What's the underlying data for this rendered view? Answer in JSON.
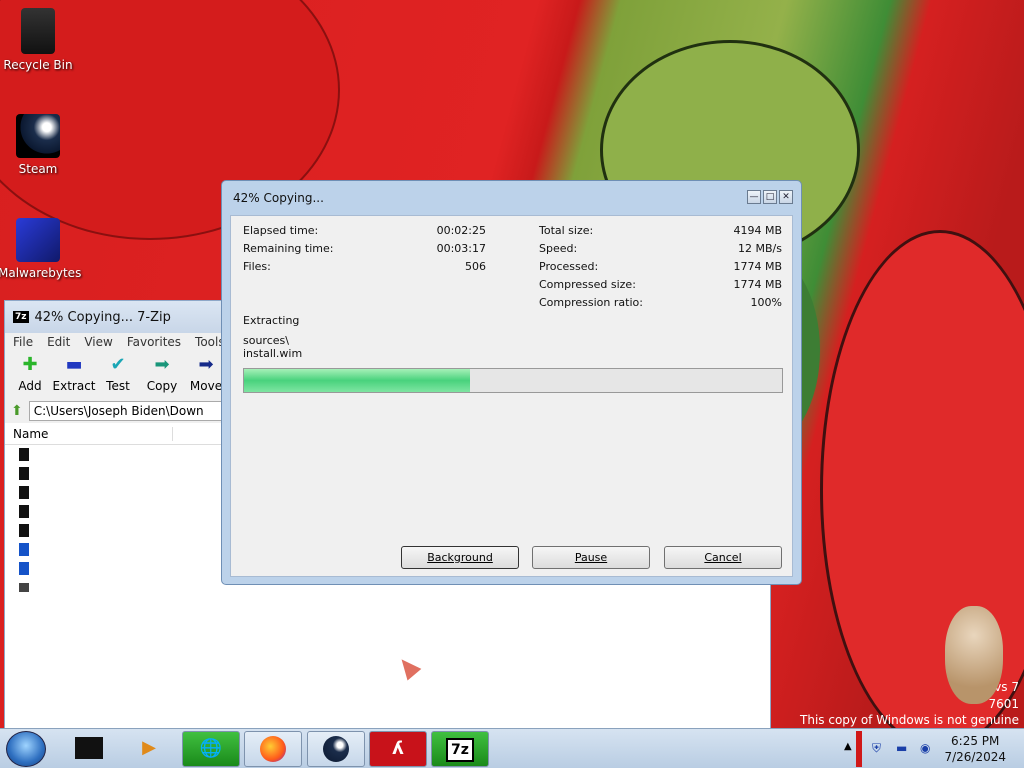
{
  "desktop": {
    "icons": [
      {
        "label": "Recycle Bin"
      },
      {
        "label": "Steam"
      },
      {
        "label": "Malwarebytes"
      }
    ],
    "watermark": {
      "line1": "vs 7",
      "line2": "7601",
      "line3": "This copy of Windows is not genuine"
    }
  },
  "zip_window": {
    "title": "42% Copying... 7-Zip",
    "logo": "7z",
    "menu": [
      "File",
      "Edit",
      "View",
      "Favorites",
      "Tools"
    ],
    "toolbar": [
      "Add",
      "Extract",
      "Test",
      "Copy",
      "Move"
    ],
    "address": "C:\\Users\\Joseph Biden\\Down",
    "columns": [
      "Name"
    ]
  },
  "dialog": {
    "title": "42% Copying...",
    "controls": {
      "minimize": "—",
      "maximize": "□",
      "close": "✕"
    },
    "left_stats": [
      {
        "label": "Elapsed time:",
        "value": "00:02:25"
      },
      {
        "label": "Remaining time:",
        "value": "00:03:17"
      },
      {
        "label": "Files:",
        "value": "506"
      }
    ],
    "right_stats": [
      {
        "label": "Total size:",
        "value": "4194 MB"
      },
      {
        "label": "Speed:",
        "value": "12 MB/s"
      },
      {
        "label": "Processed:",
        "value": "1774 MB"
      },
      {
        "label": "Compressed size:",
        "value": "1774 MB"
      },
      {
        "label": "Compression ratio:",
        "value": "100%"
      }
    ],
    "status": "Extracting",
    "path_line1": "sources\\",
    "path_line2": "install.wim",
    "progress_percent": 42,
    "buttons": {
      "background": "Background",
      "pause": "Pause",
      "cancel": "Cancel"
    }
  },
  "taskbar": {
    "pinned": [
      "explorer",
      "media-player",
      "download-manager",
      "firefox",
      "steam",
      "avira",
      "7-zip"
    ],
    "zip_label": "7z",
    "clock": {
      "time": "6:25 PM",
      "date": "7/26/2024"
    }
  }
}
